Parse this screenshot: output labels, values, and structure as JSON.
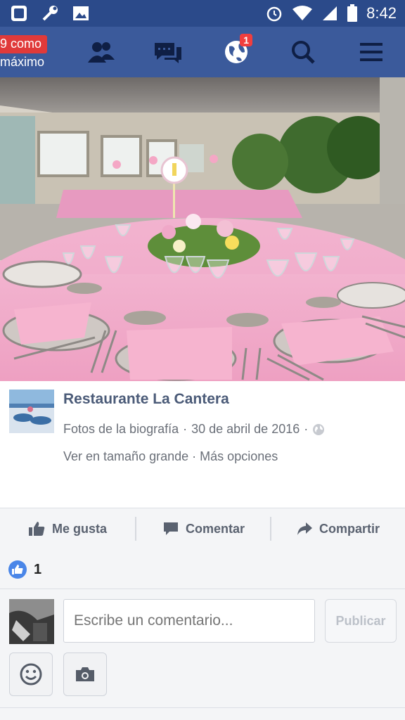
{
  "status_bar": {
    "time": "8:42"
  },
  "nav": {
    "promo_line1": "9 como",
    "promo_line2": "máximo",
    "notifications_count": "1",
    "icons": [
      "friends-icon",
      "messages-icon",
      "globe-icon",
      "search-icon",
      "menu-icon"
    ]
  },
  "post": {
    "page_name": "Restaurante La Cantera",
    "album": "Fotos de la biografía",
    "date": "30 de abril de 2016",
    "view_large": "Ver en tamaño grande",
    "more_options": "Más opciones",
    "separator": "·"
  },
  "actions": {
    "like": "Me gusta",
    "comment": "Comentar",
    "share": "Compartir"
  },
  "reactions": {
    "like_count": "1"
  },
  "composer": {
    "placeholder": "Escribe un comentario...",
    "publish": "Publicar"
  },
  "colors": {
    "nav_bg": "#3b5a9b",
    "status_bg": "#2b4a8a",
    "accent": "#4a86e8",
    "tablecloth": "#f0a8c8"
  }
}
